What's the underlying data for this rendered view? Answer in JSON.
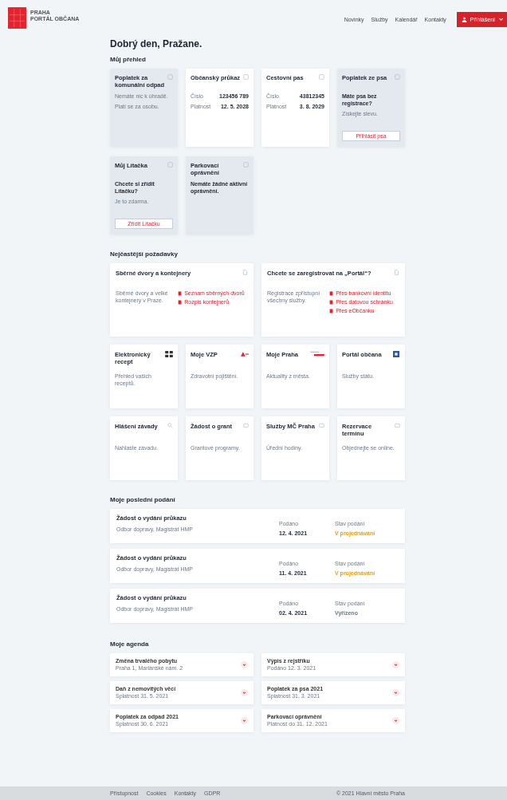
{
  "header": {
    "logo_lines": [
      "PRAHA",
      "PORTÁL OBČANA"
    ],
    "nav": [
      "Novinky",
      "Služby",
      "Kalendář",
      "Kontakty"
    ],
    "login_button": "Přihlášení"
  },
  "greeting": "Dobrý den, Pražane.",
  "overview": {
    "title": "Můj přehled",
    "cards": [
      {
        "kind": "info",
        "title": "Poplatek za komunální odpad",
        "texts": [
          "Nemáte nic k úhradě.",
          "Platí se za osobu."
        ]
      },
      {
        "kind": "details",
        "title": "Občanský průkaz",
        "rows": [
          {
            "label": "Číslo",
            "value": "123456 789"
          },
          {
            "label": "Platnost",
            "value": "12. 5. 2028"
          }
        ]
      },
      {
        "kind": "details",
        "title": "Cestovní pas",
        "rows": [
          {
            "label": "Číslo",
            "value": "43812345"
          },
          {
            "label": "Platnost",
            "value": "3. 8. 2029"
          }
        ]
      },
      {
        "kind": "question",
        "title": "Poplatek ze psa",
        "question": "Máte psa bez registrace?",
        "text": "Získejte slevu.",
        "button": "Přihlásit psa"
      },
      {
        "kind": "question",
        "title": "Můj Lítačka",
        "question": "Chcete si zřídit Lítačku?",
        "text": "Je to zdarma.",
        "button": "Zřídit Lítačku"
      },
      {
        "kind": "question",
        "title": "Parkovací oprávnění",
        "question": "Nemáte žádné aktivní oprávnění."
      }
    ]
  },
  "requests": {
    "title": "Nejčastější požadavky",
    "featured": [
      {
        "title": "Sběrné dvory a kontejnery",
        "text": "Sběrné dvory a velké kontejnery v Praze.",
        "links": [
          "Seznam sběrných dvorů",
          "Rozpis kontejnerů"
        ]
      },
      {
        "title": "Chcete se zaregistrovat na „Portál“?",
        "text": "Registrace zpřístupní všechny služby.",
        "links": [
          "Přes bankovní identitu",
          "Přes datovou schránku",
          "Přes eObčanku"
        ]
      }
    ],
    "tiles": [
      {
        "kind": "qr",
        "title": "Elektronický recept",
        "text": "Přehled vašich receptů."
      },
      {
        "kind": "brand",
        "title": "Moje VZP",
        "text": "Zdravotní pojištění."
      },
      {
        "kind": "banner",
        "title": "Moje Praha",
        "text": "Aktuality z města."
      },
      {
        "kind": "square",
        "title": "Portál občana",
        "text": "Služby státu."
      },
      {
        "kind": "search",
        "title": "Hlášení závady",
        "text": "Nahlaste závadu."
      },
      {
        "kind": "doc",
        "title": "Žádost o grant",
        "text": "Grantové programy."
      },
      {
        "kind": "doc",
        "title": "Služby MČ Praha",
        "text": "Úřední hodiny."
      },
      {
        "kind": "doc",
        "title": "Rezervace termínu",
        "text": "Objednejte se online."
      }
    ]
  },
  "submissions": {
    "title": "Moje poslední podání",
    "rows": [
      {
        "title": "Žádost o vydání průkazu",
        "text": "Odbor dopravy, Magistrát HMP",
        "date_label": "Podáno",
        "date": "12. 4. 2021",
        "status_label": "Stav podání",
        "status": "V projednávání",
        "color": "#e5a00d"
      },
      {
        "title": "Žádost o vydání průkazu",
        "text": "Odbor dopravy, Magistrát HMP",
        "date_label": "Podáno",
        "date": "11. 4. 2021",
        "status_label": "Stav podání",
        "status": "V projednávání",
        "color": "#e5a00d"
      },
      {
        "title": "Žádost o vydání průkazu",
        "text": "Odbor dopravy, Magistrát HMP",
        "date_label": "Podáno",
        "date": "02. 4. 2021",
        "status_label": "Stav podání",
        "status": "Vyřízeno",
        "color": "#6b7785"
      }
    ]
  },
  "agenda": {
    "title": "Moje agenda",
    "items": [
      {
        "title": "Změna trvalého pobytu",
        "text": "Praha 1, Mariánské nám. 2"
      },
      {
        "title": "Výpis z rejstříku",
        "text": "Podáno 12. 3. 2021"
      },
      {
        "title": "Daň z nemovitých věcí",
        "text": "Splatnost 31. 5. 2021"
      },
      {
        "title": "Poplatek za psa 2021",
        "text": "Splatnost 31. 3. 2021"
      },
      {
        "title": "Poplatek za odpad 2021",
        "text": "Splatnost 30. 6. 2021"
      },
      {
        "title": "Parkovací oprávnění",
        "text": "Platnost do 31. 12. 2021"
      }
    ]
  },
  "footer": {
    "links": [
      "Přístupnost",
      "Cookies",
      "Kontakty",
      "GDPR"
    ],
    "copyright": "© 2021 Hlavní město Praha"
  }
}
